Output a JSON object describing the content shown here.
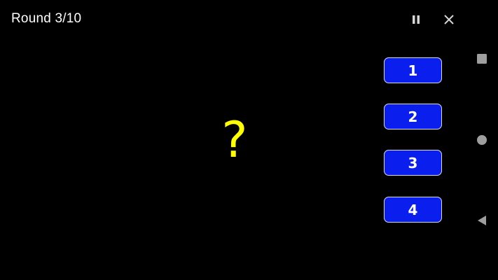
{
  "header": {
    "round_label": "Round 3/10",
    "pause_icon": "pause-icon",
    "close_icon": "close-icon"
  },
  "main": {
    "prompt_symbol": "?",
    "prompt_color": "#ffff00"
  },
  "answers": [
    {
      "label": "1"
    },
    {
      "label": "2"
    },
    {
      "label": "3"
    },
    {
      "label": "4"
    }
  ],
  "answer_style": {
    "background": "#0a1eee",
    "border": "#d9dcff"
  },
  "nav_bar": {
    "recents_icon": "square-icon",
    "home_icon": "circle-icon",
    "back_icon": "triangle-back-icon",
    "icon_color": "#9e9e9e"
  }
}
